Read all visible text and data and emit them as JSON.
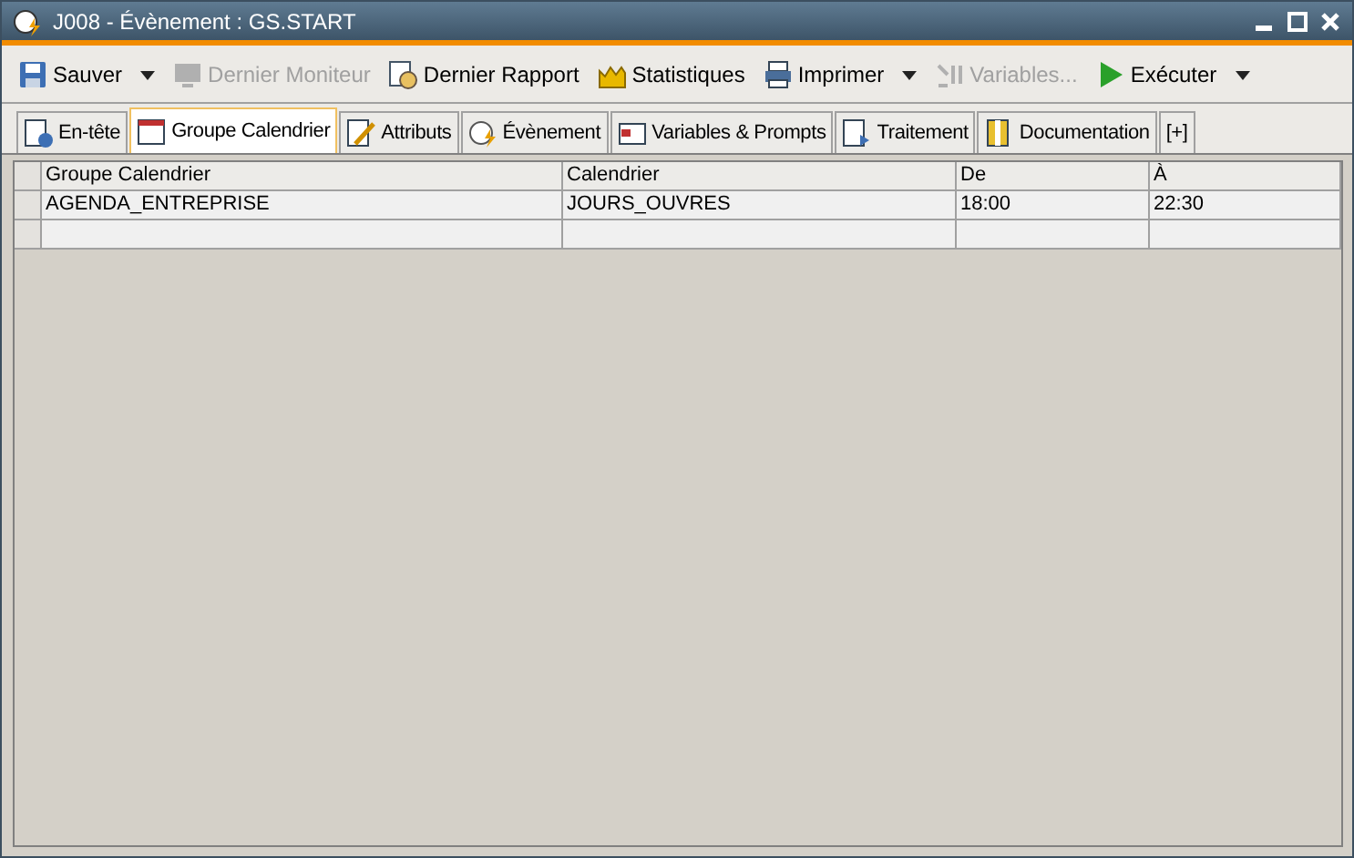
{
  "window": {
    "title": "J008 - Évènement : GS.START"
  },
  "toolbar": [
    {
      "label": "Sauver",
      "disabled": false,
      "dropdown": true
    },
    {
      "label": "Dernier Moniteur",
      "disabled": true,
      "dropdown": false
    },
    {
      "label": "Dernier Rapport",
      "disabled": false,
      "dropdown": false
    },
    {
      "label": "Statistiques",
      "disabled": false,
      "dropdown": false
    },
    {
      "label": "Imprimer",
      "disabled": false,
      "dropdown": true
    },
    {
      "label": "Variables...",
      "disabled": true,
      "dropdown": false
    },
    {
      "label": "Exécuter",
      "disabled": false,
      "dropdown": true
    }
  ],
  "tabs": [
    {
      "label": "En-tête",
      "selected": false
    },
    {
      "label": "Groupe Calendrier",
      "selected": true
    },
    {
      "label": "Attributs",
      "selected": false
    },
    {
      "label": "Évènement",
      "selected": false
    },
    {
      "label": "Variables & Prompts",
      "selected": false
    },
    {
      "label": "Traitement",
      "selected": false
    },
    {
      "label": "Documentation",
      "selected": false
    },
    {
      "label": "[+]",
      "selected": false
    }
  ],
  "table": {
    "columns": [
      "Groupe Calendrier",
      "Calendrier",
      "De",
      "À"
    ],
    "rows": [
      [
        "AGENDA_ENTREPRISE",
        "JOURS_OUVRES",
        "18:00",
        "22:30"
      ]
    ]
  }
}
